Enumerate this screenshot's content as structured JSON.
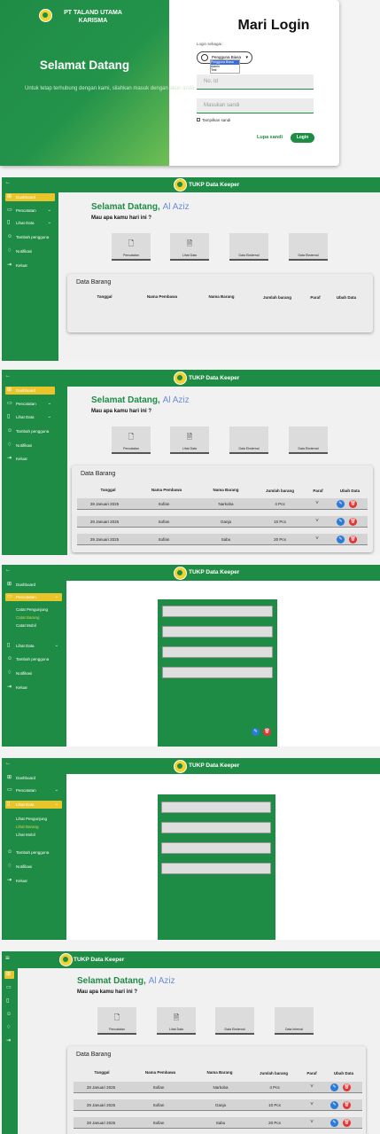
{
  "login": {
    "company": "PT TALAND UTAMA KARISMA",
    "welcome": "Selamat Datang",
    "subtitle": "Untuk tetap terhubung dengan kami, silahkan masuk dengan akun anda",
    "title": "Mari Login",
    "login_as_label": "Login sebagai :",
    "role_selected": "Pengguna Biasa",
    "role_options": [
      "Pengguna Biasa",
      "Admin",
      "Test"
    ],
    "id_placeholder": "No. Id",
    "password_placeholder": "Masukan sandi",
    "show_password": "Tampilkan sandi",
    "forgot": "Lupa sandi",
    "login_button": "Login"
  },
  "app": {
    "title": "TUKP Data Keeper",
    "greeting": "Selamat Datang,",
    "user": "Al Aziz",
    "question": "Mau apa kamu hari ini ?"
  },
  "menu": {
    "dashboard": "Dashboard",
    "pencatatan": "Pencatatan",
    "lihat_data": "Lihat Data",
    "tambah": "Tambah pengguna",
    "notifikasi": "Notifikasi",
    "keluar": "Keluar",
    "pencatatan_sub": [
      "Catat Pengunjung",
      "Catat Barang",
      "Catat Mobil"
    ],
    "lihat_sub": [
      "Lihat Pengunjung",
      "Lihat Barang",
      "Lihat Mobil"
    ],
    "f3_tambah": "Tambah pengguna",
    "f3_notif": "Notifikasi",
    "f4_notif": "Notifikasi",
    "f2_notif": "Notifikasi",
    "f2_keluar": "Keluar"
  },
  "cards": [
    {
      "label": "Pencatatan",
      "icon": "add-file-icon"
    },
    {
      "label": "Lihat Data",
      "icon": "document-icon"
    },
    {
      "label": "Data Eksternal",
      "icon": ""
    },
    {
      "label": "Data Eksternal",
      "icon": ""
    }
  ],
  "cards_f6": [
    {
      "label": "Pencatatan"
    },
    {
      "label": "Lihat Data"
    },
    {
      "label": "Data Eksternal"
    },
    {
      "label": "Data Internal"
    }
  ],
  "table": {
    "title": "Data Barang",
    "headers": [
      "Tanggal",
      "Nama Pembawa",
      "Nama Barang",
      "Jumlah barang",
      "Paraf",
      "Ubah Data"
    ],
    "rows": [
      [
        "28 Januari 2025",
        "Sofian",
        "Narkoba",
        "4 Pcs",
        "V"
      ],
      [
        "29 Januari 2025",
        "Sofian",
        "Ganja",
        "10 Pcs",
        "V"
      ],
      [
        "29 Januari 2025",
        "Sofian",
        "Sabu",
        "20 Pcs",
        "V"
      ]
    ]
  },
  "colors": {
    "primary": "#1f8c46",
    "accent": "#e9c42b",
    "edit": "#2b7bd8",
    "delete": "#e23636"
  }
}
